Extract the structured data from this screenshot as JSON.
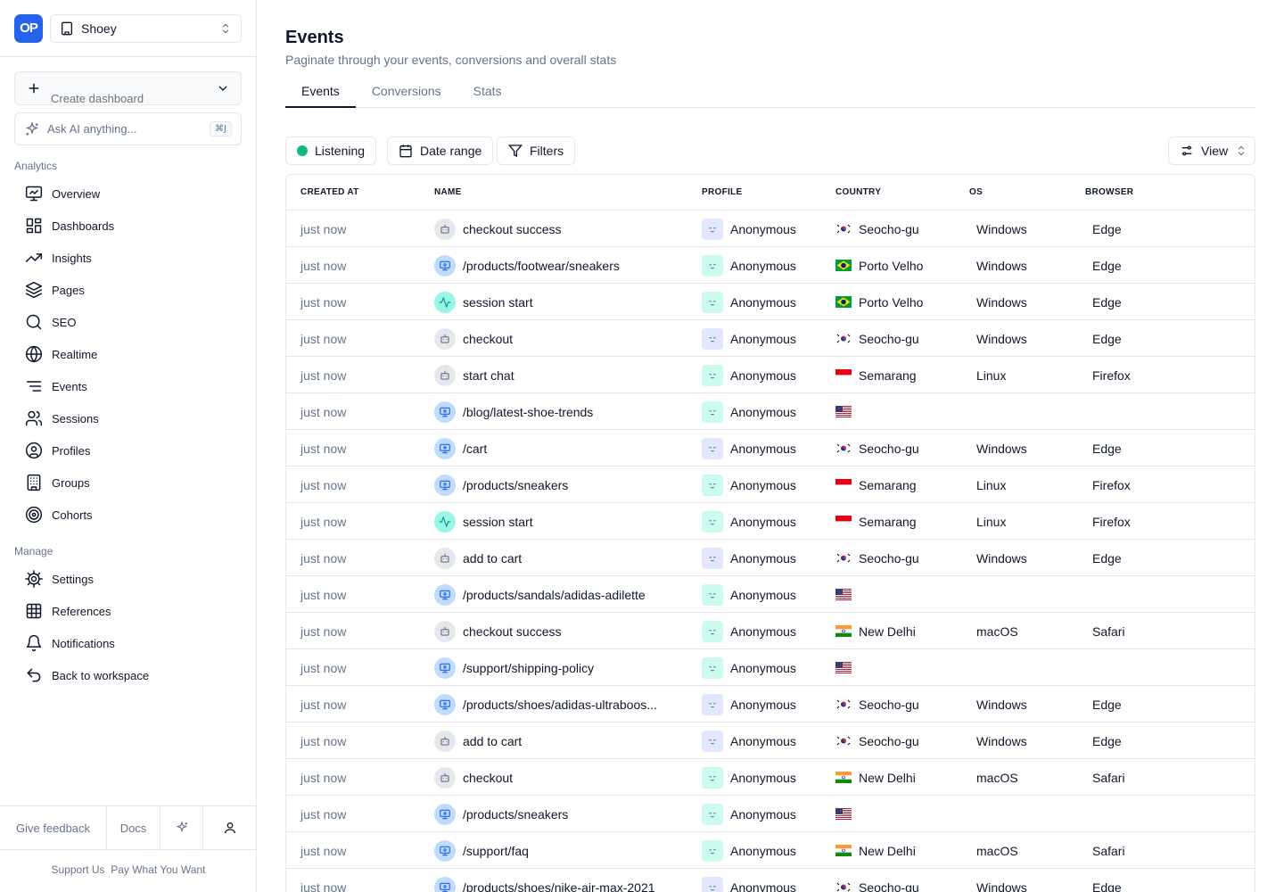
{
  "app": {
    "logo_text": "OP",
    "project": "Shoey"
  },
  "sidebar": {
    "create_dashboard": "Create dashboard",
    "ask_ai": {
      "placeholder": "Ask AI anything...",
      "shortcut": "⌘J"
    },
    "analytics_label": "Analytics",
    "analytics_items": [
      {
        "label": "Overview",
        "icon": "presentation-icon"
      },
      {
        "label": "Dashboards",
        "icon": "layout-icon"
      },
      {
        "label": "Insights",
        "icon": "trending-icon"
      },
      {
        "label": "Pages",
        "icon": "layers-icon"
      },
      {
        "label": "SEO",
        "icon": "search-icon"
      },
      {
        "label": "Realtime",
        "icon": "globe-icon"
      },
      {
        "label": "Events",
        "icon": "list-icon"
      },
      {
        "label": "Sessions",
        "icon": "users-icon"
      },
      {
        "label": "Profiles",
        "icon": "user-circle-icon"
      },
      {
        "label": "Groups",
        "icon": "building-icon"
      },
      {
        "label": "Cohorts",
        "icon": "target-icon"
      }
    ],
    "manage_label": "Manage",
    "manage_items": [
      {
        "label": "Settings",
        "icon": "gear-icon"
      },
      {
        "label": "References",
        "icon": "grid-icon"
      },
      {
        "label": "Notifications",
        "icon": "bell-icon"
      },
      {
        "label": "Back to workspace",
        "icon": "undo-icon"
      }
    ],
    "footer": {
      "feedback": "Give feedback",
      "docs": "Docs",
      "support": "Support Us",
      "pay": "Pay What You Want"
    }
  },
  "page": {
    "title": "Events",
    "subtitle": "Paginate through your events, conversions and overall stats",
    "tabs": [
      "Events",
      "Conversions",
      "Stats"
    ],
    "active_tab": "Events"
  },
  "toolbar": {
    "listening": "Listening",
    "date_range": "Date range",
    "filters": "Filters",
    "view": "View"
  },
  "table": {
    "columns": [
      "CREATED AT",
      "NAME",
      "PROFILE",
      "COUNTRY",
      "OS",
      "BROWSER"
    ],
    "rows": [
      {
        "time": "just now",
        "type": "event",
        "name": "checkout success",
        "profile": "Anonymous",
        "flag": "kr",
        "city": "Seocho-gu",
        "os": "Windows",
        "browser": "Edge"
      },
      {
        "time": "just now",
        "type": "page",
        "name": "/products/footwear/sneakers",
        "profile": "Anonymous",
        "flag": "br",
        "city": "Porto Velho",
        "os": "Windows",
        "browser": "Edge"
      },
      {
        "time": "just now",
        "type": "session",
        "name": "session start",
        "profile": "Anonymous",
        "flag": "br",
        "city": "Porto Velho",
        "os": "Windows",
        "browser": "Edge"
      },
      {
        "time": "just now",
        "type": "event",
        "name": "checkout",
        "profile": "Anonymous",
        "flag": "kr",
        "city": "Seocho-gu",
        "os": "Windows",
        "browser": "Edge"
      },
      {
        "time": "just now",
        "type": "event",
        "name": "start chat",
        "profile": "Anonymous",
        "flag": "id",
        "city": "Semarang",
        "os": "Linux",
        "browser": "Firefox"
      },
      {
        "time": "just now",
        "type": "page",
        "name": "/blog/latest-shoe-trends",
        "profile": "Anonymous",
        "flag": "us",
        "city": "",
        "os": "",
        "browser": ""
      },
      {
        "time": "just now",
        "type": "page",
        "name": "/cart",
        "profile": "Anonymous",
        "flag": "kr",
        "city": "Seocho-gu",
        "os": "Windows",
        "browser": "Edge"
      },
      {
        "time": "just now",
        "type": "page",
        "name": "/products/sneakers",
        "profile": "Anonymous",
        "flag": "id",
        "city": "Semarang",
        "os": "Linux",
        "browser": "Firefox"
      },
      {
        "time": "just now",
        "type": "session",
        "name": "session start",
        "profile": "Anonymous",
        "flag": "id",
        "city": "Semarang",
        "os": "Linux",
        "browser": "Firefox"
      },
      {
        "time": "just now",
        "type": "event",
        "name": "add to cart",
        "profile": "Anonymous",
        "flag": "kr",
        "city": "Seocho-gu",
        "os": "Windows",
        "browser": "Edge"
      },
      {
        "time": "just now",
        "type": "page",
        "name": "/products/sandals/adidas-adilette",
        "profile": "Anonymous",
        "flag": "us",
        "city": "",
        "os": "",
        "browser": ""
      },
      {
        "time": "just now",
        "type": "event",
        "name": "checkout success",
        "profile": "Anonymous",
        "flag": "in",
        "city": "New Delhi",
        "os": "macOS",
        "browser": "Safari"
      },
      {
        "time": "just now",
        "type": "page",
        "name": "/support/shipping-policy",
        "profile": "Anonymous",
        "flag": "us",
        "city": "",
        "os": "",
        "browser": ""
      },
      {
        "time": "just now",
        "type": "page",
        "name": "/products/shoes/adidas-ultraboos...",
        "profile": "Anonymous",
        "flag": "kr",
        "city": "Seocho-gu",
        "os": "Windows",
        "browser": "Edge"
      },
      {
        "time": "just now",
        "type": "event",
        "name": "add to cart",
        "profile": "Anonymous",
        "flag": "kr",
        "city": "Seocho-gu",
        "os": "Windows",
        "browser": "Edge"
      },
      {
        "time": "just now",
        "type": "event",
        "name": "checkout",
        "profile": "Anonymous",
        "flag": "in",
        "city": "New Delhi",
        "os": "macOS",
        "browser": "Safari"
      },
      {
        "time": "just now",
        "type": "page",
        "name": "/products/sneakers",
        "profile": "Anonymous",
        "flag": "us",
        "city": "",
        "os": "",
        "browser": ""
      },
      {
        "time": "just now",
        "type": "page",
        "name": "/support/faq",
        "profile": "Anonymous",
        "flag": "in",
        "city": "New Delhi",
        "os": "macOS",
        "browser": "Safari"
      },
      {
        "time": "just now",
        "type": "page",
        "name": "/products/shoes/nike-air-max-2021",
        "profile": "Anonymous",
        "flag": "kr",
        "city": "Seocho-gu",
        "os": "Windows",
        "browser": "Edge"
      }
    ]
  },
  "colors": {
    "brand": "#2563eb",
    "listening": "#10b981",
    "page_icon_bg": "#bfdbfe",
    "session_icon_bg": "#99f6e4",
    "event_icon_bg": "#e5e7eb"
  }
}
